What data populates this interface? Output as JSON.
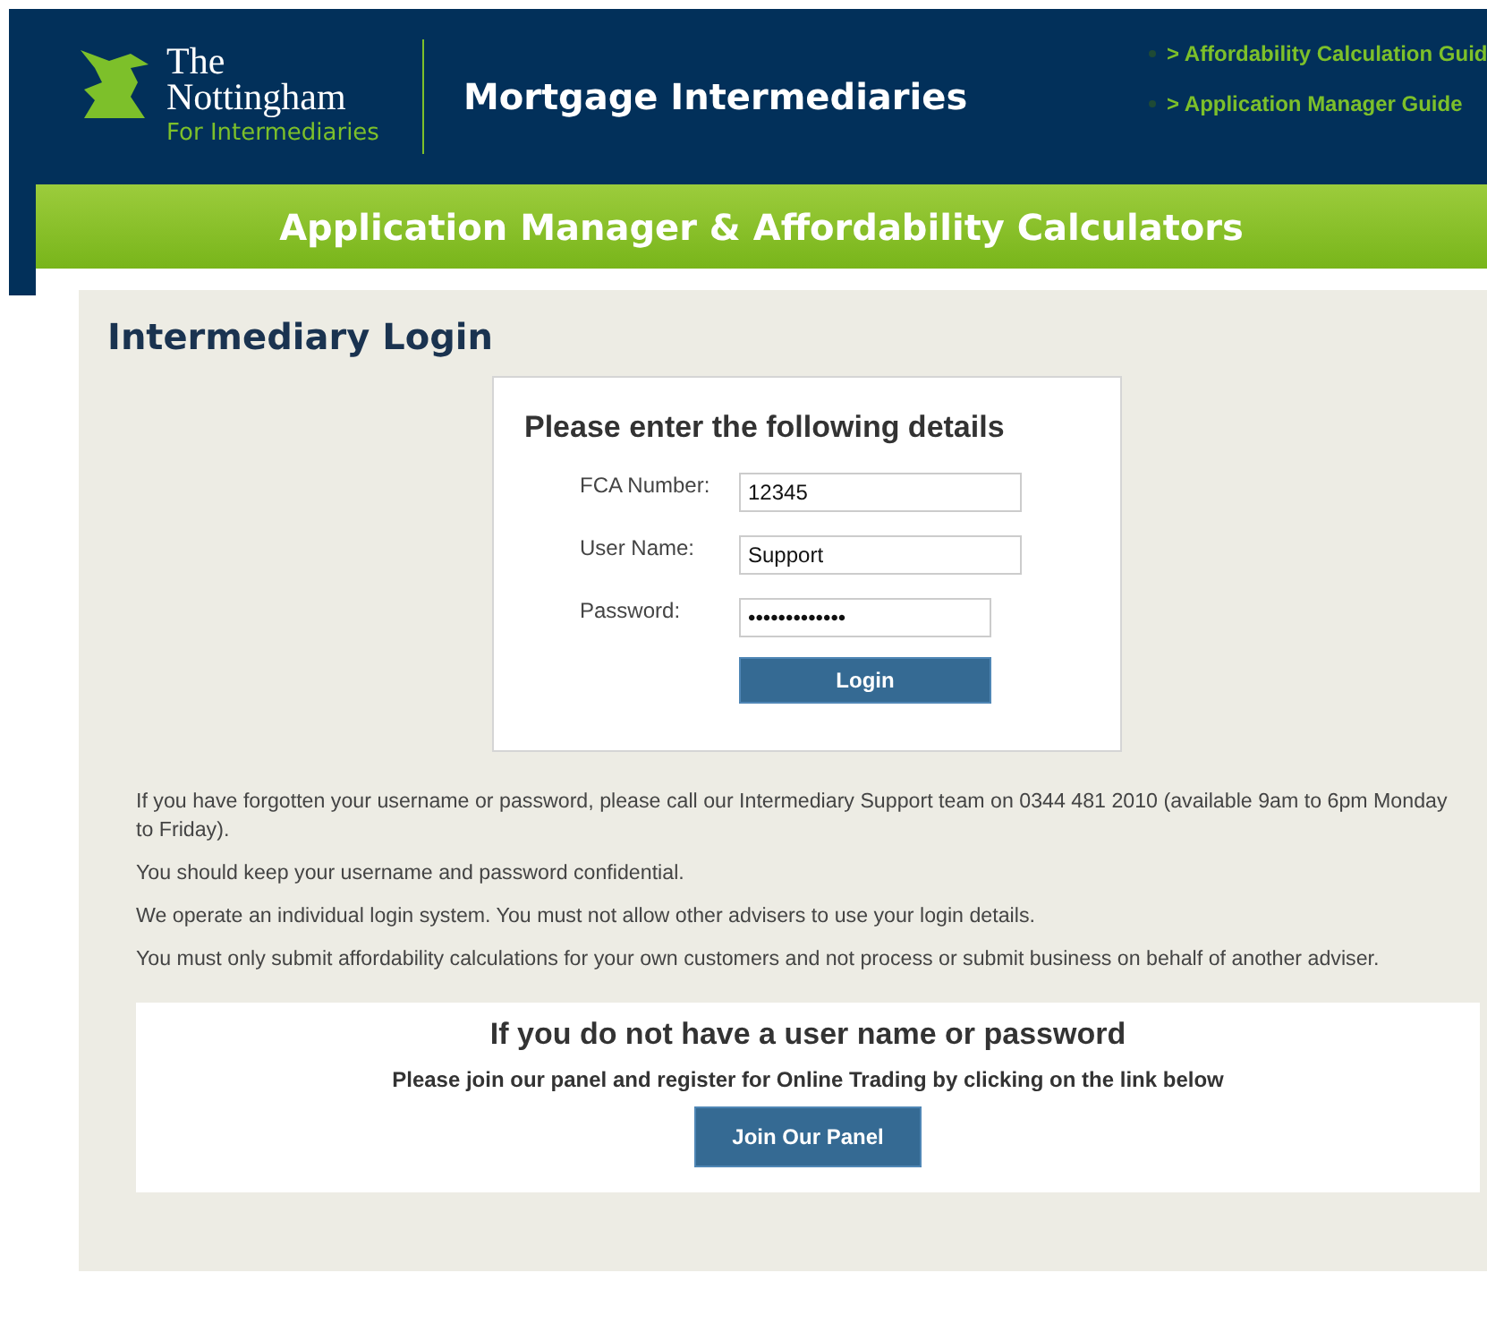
{
  "header": {
    "logo": {
      "line_1": "The",
      "line_2": "Nottingham",
      "line_3": "For Intermediaries"
    },
    "title": "Mortgage Intermediaries",
    "links": [
      "> Affordability Calculation Guid",
      "> Application Manager Guide"
    ]
  },
  "banner": "Application Manager & Affordability Calculators",
  "page_title": "Intermediary Login",
  "login": {
    "heading": "Please enter the following details",
    "fields": [
      {
        "label": "FCA Number:",
        "value": "12345",
        "kind": "text"
      },
      {
        "label": "User Name:",
        "value": "Support",
        "kind": "text"
      },
      {
        "label": "Password:",
        "value": "•••••••••••••",
        "kind": "password"
      }
    ],
    "button": "Login"
  },
  "notes": [
    "If you have forgotten your username or password, please call our Intermediary Support team on 0344 481 2010 (available 9am to 6pm Monday to Friday).",
    "You should keep your username and password confidential.",
    "We operate an individual login system. You must not allow other advisers to use your login details.",
    "You must only submit affordability calculations for your own customers and not process or submit business on behalf of another adviser."
  ],
  "register": {
    "heading": "If you do not have a user name or password",
    "text": "Please join our panel and register for Online Trading by clicking on the link below",
    "button": "Join Our Panel"
  }
}
